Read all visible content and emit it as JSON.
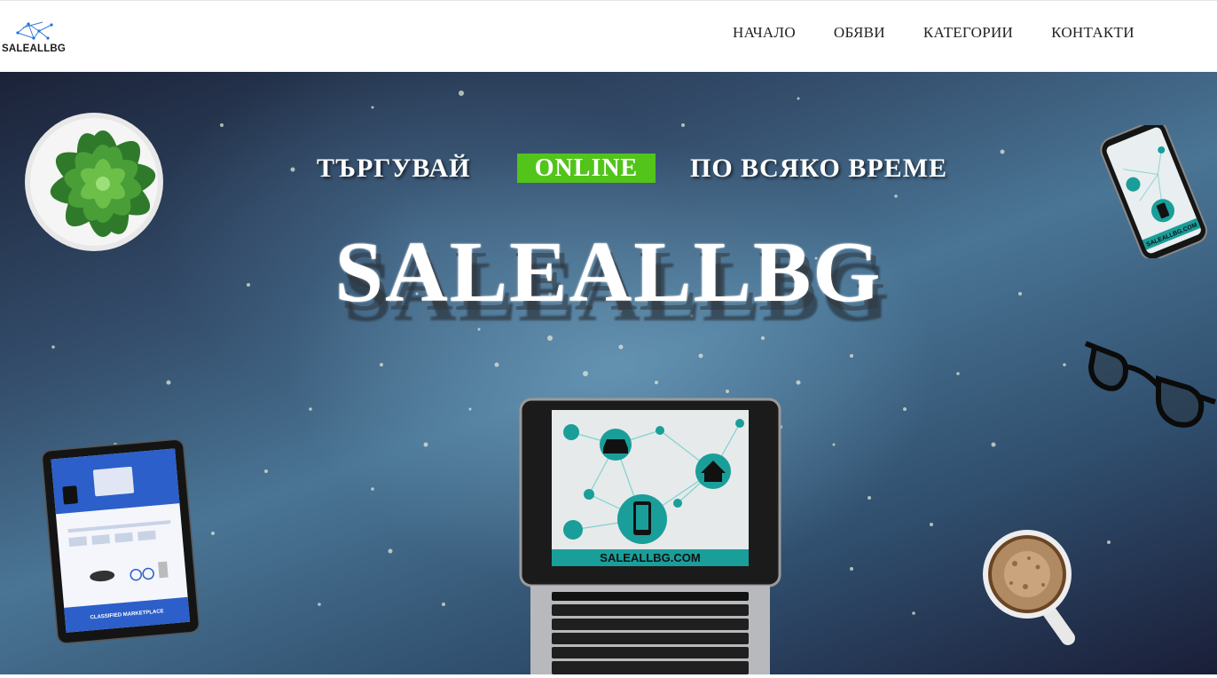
{
  "header": {
    "logo_text": "SALEALLBG",
    "nav": [
      {
        "label": "НАЧАЛО"
      },
      {
        "label": "ОБЯВИ"
      },
      {
        "label": "КАТЕГОРИИ"
      },
      {
        "label": "КОНТАКТИ"
      }
    ]
  },
  "hero": {
    "tagline_left": "ТЪРГУВАЙ",
    "tagline_highlight": "ONLINE",
    "tagline_right": "ПО ВСЯКО ВРЕМЕ",
    "brand": "SALEALLBG",
    "laptop_screen_text": "SALEALLBG.COM",
    "phone_screen_text": "SALEALLBG.COM",
    "tablet_banner_text": "CLASSIFIED MARKETPLACE",
    "highlight_color": "#52c41a",
    "accent_color": "#1a9e9a"
  },
  "icons": [
    "logo-network-icon",
    "car-icon",
    "house-icon",
    "smartphone-icon"
  ]
}
